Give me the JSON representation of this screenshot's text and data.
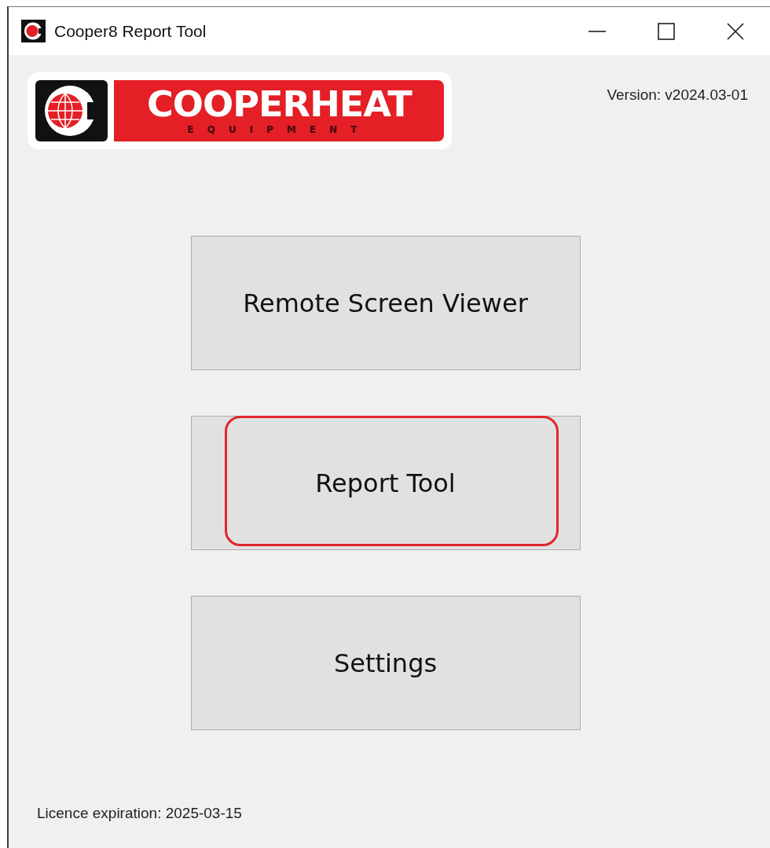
{
  "window": {
    "title": "Cooper8 Report Tool"
  },
  "logo": {
    "name": "COOPERHEAT",
    "tagline": "EQUIPMENT"
  },
  "version": "Version: v2024.03-01",
  "buttons": [
    {
      "label": "Remote Screen Viewer",
      "highlighted": false
    },
    {
      "label": "Report Tool",
      "highlighted": true
    },
    {
      "label": "Settings",
      "highlighted": false
    }
  ],
  "licence": "Licence expiration: 2025-03-15"
}
